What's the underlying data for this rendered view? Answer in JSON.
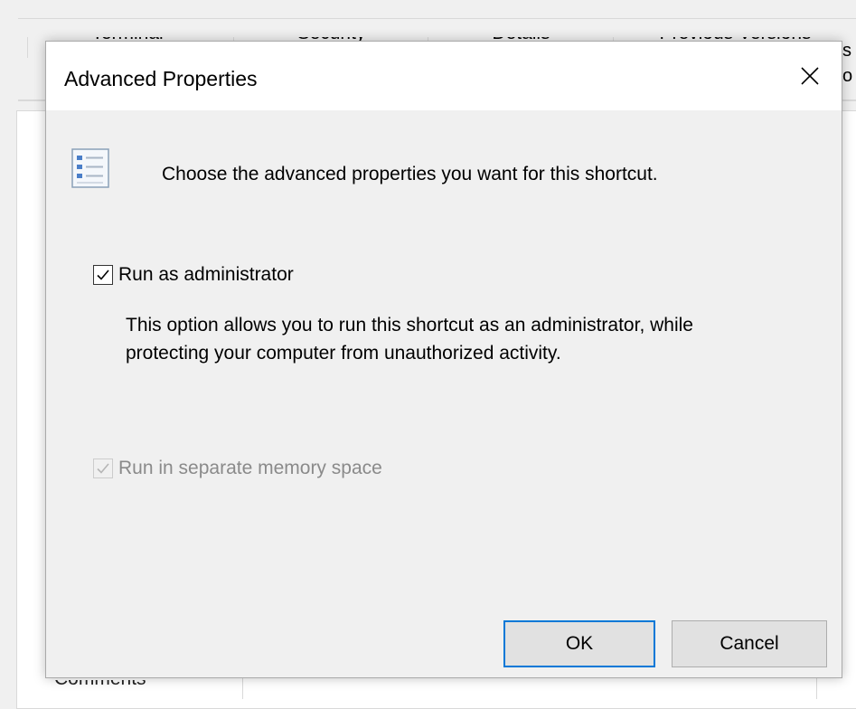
{
  "background_window": {
    "tabs": [
      "Terminal",
      "Security",
      "Details",
      "Previous Versions"
    ],
    "bottom_label": "Comments",
    "right_edge_text_1": "s",
    "right_edge_text_2": "o"
  },
  "dialog": {
    "title": "Advanced Properties",
    "header_text": "Choose the advanced properties you want for this shortcut.",
    "run_as_admin": {
      "label": "Run as administrator",
      "checked": true,
      "enabled": true
    },
    "description": "This option allows you to run this shortcut as an administrator, while protecting your computer from unauthorized activity.",
    "separate_memory": {
      "label": "Run in separate memory space",
      "checked": true,
      "enabled": false
    },
    "ok_label": "OK",
    "cancel_label": "Cancel"
  },
  "icons": {
    "close": "close-icon",
    "header": "checklist-icon",
    "check": "checkmark-icon"
  },
  "colors": {
    "dialog_bg": "#f0f0f0",
    "titlebar_bg": "#ffffff",
    "accent_focus": "#0078d7",
    "disabled_text": "#8a8a8a"
  }
}
